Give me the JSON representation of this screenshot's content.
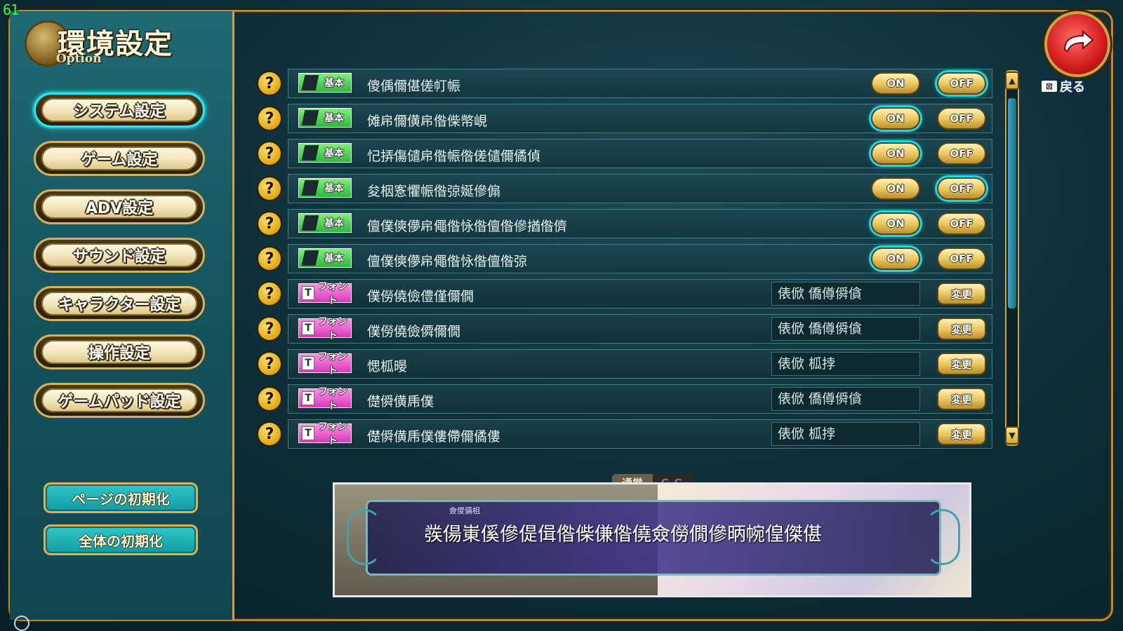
{
  "hud": {
    "fps": "61"
  },
  "title": {
    "main": "環境設定",
    "sub": "Option"
  },
  "menu": [
    {
      "label": "システム設定",
      "active": true
    },
    {
      "label": "ゲーム設定",
      "active": false
    },
    {
      "label": "ADV設定",
      "active": false
    },
    {
      "label": "サウンド設定",
      "active": false
    },
    {
      "label": "キャラクター設定",
      "active": false
    },
    {
      "label": "操作設定",
      "active": false
    },
    {
      "label": "ゲームパッド設定",
      "active": false
    }
  ],
  "reset": {
    "page": "ページの初期化",
    "all": "全体の初期化"
  },
  "back": {
    "key_icon": "⊠",
    "label": "戻る"
  },
  "help_glyph": "?",
  "tags": {
    "basic": "基本",
    "font": "フォント",
    "font_icon": "T"
  },
  "toggle": {
    "on": "ON",
    "off": "OFF",
    "change": "変更"
  },
  "settings": [
    {
      "type": "basic",
      "label": "傻偊儞偡傞帄帪",
      "selected": "off"
    },
    {
      "type": "basic",
      "label": "傩帍儞僙帍偺偨幤峴",
      "selected": "on"
    },
    {
      "type": "basic",
      "label": "忋挵傷儙帍偺帪偺傞儙儞僪偵",
      "selected": "on"
    },
    {
      "type": "basic",
      "label": "夋栶愙懼帪偺弶娫傪傓",
      "selected": "off"
    },
    {
      "type": "basic",
      "label": "儃僕傸儚帍僶偺怺偺儃偺傪揂偺儕",
      "selected": "on"
    },
    {
      "type": "basic",
      "label": "儃僕傸儚帍僶偺怺偺儃偺弶",
      "selected": "on"
    },
    {
      "type": "font",
      "label": "僕僗僥儉僼僅儞僩",
      "font": "俵俽 僑僔僢僋"
    },
    {
      "type": "font",
      "label": "僕僗僥儉僲儞僩",
      "font": "俵俽 僑僔僢僋"
    },
    {
      "type": "font",
      "label": "愢柧暥",
      "font": "俵俽 柧挬"
    },
    {
      "type": "font",
      "label": "儊僢僙乕僕",
      "font": "俵俽 僑僔僢僋"
    },
    {
      "type": "font",
      "label": "儊僢僙乕僕僂僀儞僪僂",
      "font": "俵俽 柧挬"
    }
  ],
  "scroll": {
    "up_icon": "▲",
    "down_icon": "▼"
  },
  "preview": {
    "tab_normal": "通常",
    "tab_cg": "ＣＧ",
    "speaker": "僉儍儔柤",
    "text": "彂偒崬傒傪偍偮偺偨傔偺僥僉僗僩傪昞帵偟傑偡"
  }
}
